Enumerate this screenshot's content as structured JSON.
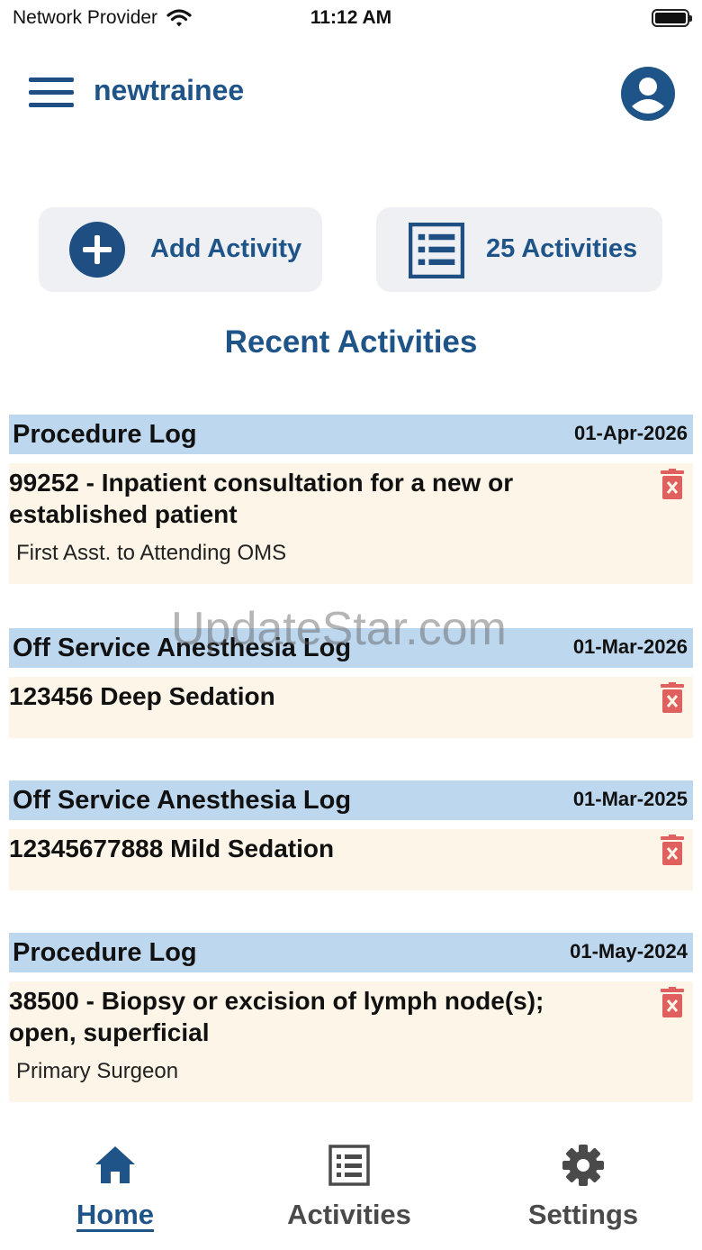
{
  "status_bar": {
    "carrier": "Network Provider",
    "time": "11:12 AM"
  },
  "header": {
    "title": "newtrainee"
  },
  "actions": {
    "add_label": "Add Activity",
    "count_label": "25 Activities"
  },
  "section": {
    "title": "Recent Activities"
  },
  "activities": [
    {
      "type": "Procedure Log",
      "date": "01-Apr-2026",
      "description": " 99252 - Inpatient consultation for a new or established patient",
      "role": "First Asst. to Attending OMS"
    },
    {
      "type": "Off Service Anesthesia Log",
      "date": "01-Mar-2026",
      "description": " 123456 Deep Sedation",
      "role": ""
    },
    {
      "type": "Off Service Anesthesia Log",
      "date": "01-Mar-2025",
      "description": " 12345677888 Mild Sedation",
      "role": ""
    },
    {
      "type": "Procedure Log",
      "date": "01-May-2024",
      "description": " 38500 - Biopsy or excision of lymph node(s); open, superficial",
      "role": "Primary Surgeon"
    }
  ],
  "watermark": "UpdateStar.com",
  "nav": {
    "home": "Home",
    "activities": "Activities",
    "settings": "Settings"
  },
  "colors": {
    "brand": "#1f5488",
    "card_header": "#bdd7ee",
    "card_body": "#fdf6e8",
    "delete": "#e06060"
  }
}
